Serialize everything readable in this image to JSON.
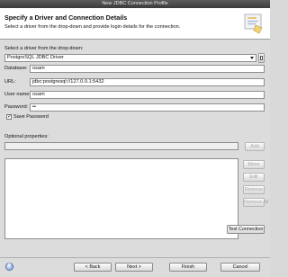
{
  "window": {
    "title": "New JDBC Connection Profile"
  },
  "banner": {
    "title": "Specify a Driver and Connection Details",
    "description": "Select a driver from the drop-down and provide login details for the connection."
  },
  "driver": {
    "label": "Select a driver from the drop-down:",
    "selected": "PostgreSQL JDBC Driver"
  },
  "form": {
    "database_label": "Database:",
    "database_value": "osam",
    "url_label": "URL:",
    "url_value": "jdbc:postgresql://127.0.0.1:5432",
    "username_label": "User name:",
    "username_value": "osam",
    "password_label": "Password:",
    "password_value": "••",
    "save_password_label": "Save Password",
    "save_password_checked": "✓"
  },
  "optional": {
    "label": "Optional properties:",
    "add_label": "Add",
    "buttons": [
      "Move",
      "Edit",
      "Remove",
      "Remove All"
    ]
  },
  "test_connection_label": "Test Connection",
  "footer": {
    "help_icon": "?",
    "back_label": "< Back",
    "next_label": "Next >",
    "finish_label": "Finish",
    "cancel_label": "Cancel"
  }
}
